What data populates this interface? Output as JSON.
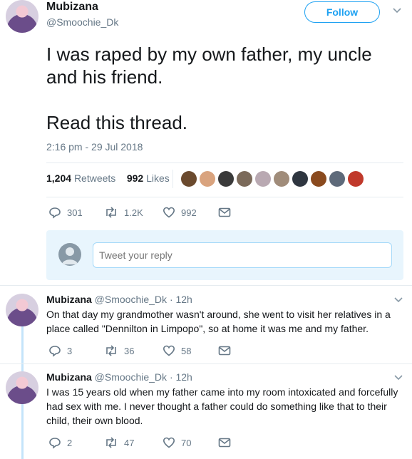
{
  "main_tweet": {
    "author_name": "Mubizana",
    "author_handle": "@Smoochie_Dk",
    "follow_label": "Follow",
    "text": "I was raped by my own father, my uncle\nand his friend.\n\nRead this thread.",
    "timestamp": "2:16 pm - 29 Jul 2018",
    "retweets_count": "1,204",
    "retweets_label": "Retweets",
    "likes_count": "992",
    "likes_label": "Likes",
    "actions": {
      "replies": "301",
      "retweets": "1.2K",
      "likes": "992"
    }
  },
  "reply_box": {
    "placeholder": "Tweet your reply"
  },
  "replies": [
    {
      "author_name": "Mubizana",
      "author_handle": "@Smoochie_Dk",
      "time": "· 12h",
      "text": "On that day my grandmother wasn't around, she went to visit her relatives in a place called \"Dennilton in Limpopo\", so at home it was me and my father.",
      "actions": {
        "replies": "3",
        "retweets": "36",
        "likes": "58"
      }
    },
    {
      "author_name": "Mubizana",
      "author_handle": "@Smoochie_Dk",
      "time": "· 12h",
      "text": "I was 15 years old when my father came into my room intoxicated and forcefully had sex with me. I never thought a father could do something like that to their child, their own blood.",
      "actions": {
        "replies": "2",
        "retweets": "47",
        "likes": "70"
      }
    }
  ],
  "colors": {
    "accent": "#1da1f2",
    "muted": "#657786",
    "thread_line": "#c4e4fa"
  }
}
